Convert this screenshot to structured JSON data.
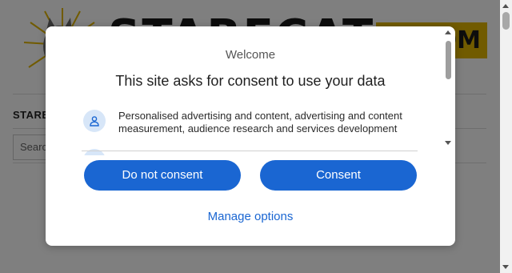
{
  "site": {
    "logo_text": "STARECAT",
    "logo_box_text": ".COM",
    "sidebar_title": "STARE",
    "search_placeholder": "Search"
  },
  "dialog": {
    "welcome": "Welcome",
    "headline": "This site asks for consent to use your data",
    "purposes": [
      {
        "icon": "person-icon",
        "text": "Personalised advertising and content, advertising and content measurement, audience research and services development"
      }
    ],
    "buttons": {
      "do_not_consent": "Do not consent",
      "consent": "Consent",
      "manage": "Manage options"
    }
  },
  "colors": {
    "primary": "#1a66d2",
    "logo_accent": "#e2b600",
    "icon_bg": "#d7e6f8"
  }
}
